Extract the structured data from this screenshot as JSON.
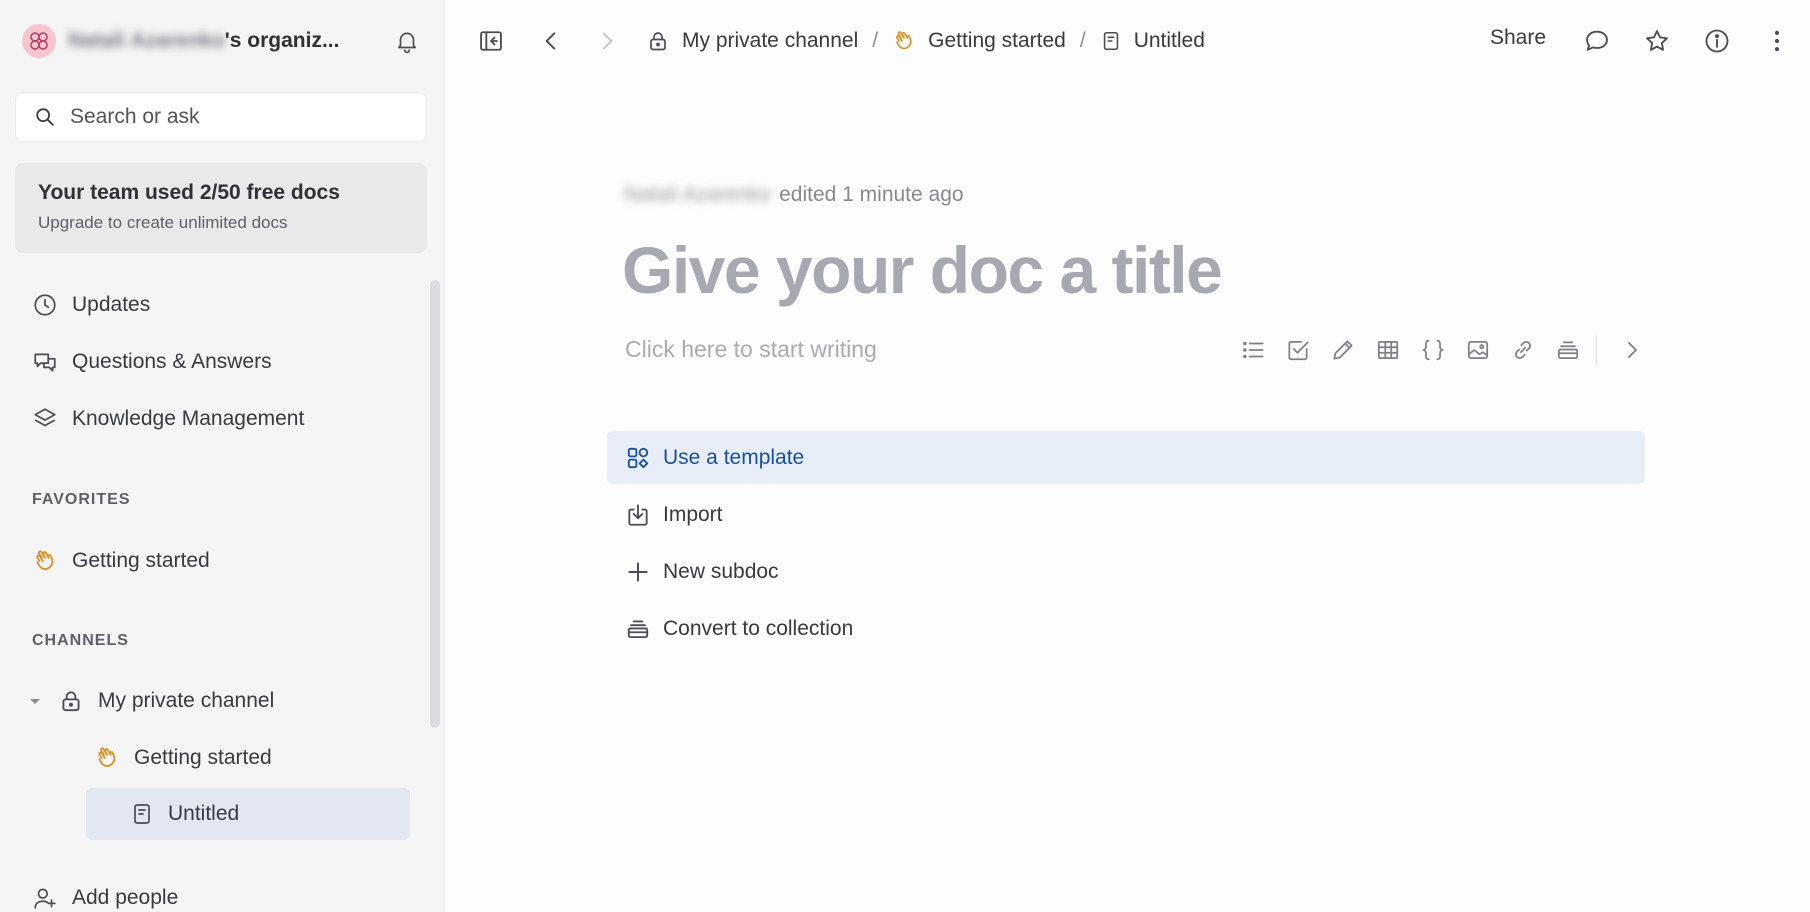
{
  "sidebar": {
    "org": {
      "owner_name": "Natali Azarenko",
      "name_suffix": "'s organiz..."
    },
    "search": {
      "placeholder": "Search or ask"
    },
    "upgrade": {
      "title": "Your team used 2/50 free docs",
      "subtitle": "Upgrade to create unlimited docs"
    },
    "nav": [
      {
        "label": "Updates",
        "icon": "clock-icon"
      },
      {
        "label": "Questions & Answers",
        "icon": "chat-bubbles-icon"
      },
      {
        "label": "Knowledge Management",
        "icon": "layers-icon"
      }
    ],
    "favorites": {
      "heading": "FAVORITES",
      "items": [
        {
          "label": "Getting started",
          "icon": "waving-hand-icon"
        }
      ]
    },
    "channels": {
      "heading": "CHANNELS",
      "channel": {
        "label": "My private channel",
        "icon": "lock-icon",
        "expanded": true
      },
      "children": [
        {
          "label": "Getting started",
          "icon": "waving-hand-icon"
        },
        {
          "label": "Untitled",
          "icon": "document-icon",
          "selected": true
        }
      ]
    },
    "add_people": "Add people"
  },
  "topbar": {
    "breadcrumbs": [
      {
        "label": "My private channel",
        "icon": "lock-icon"
      },
      {
        "label": "Getting started",
        "icon": "waving-hand-icon"
      },
      {
        "label": "Untitled",
        "icon": "document-icon"
      }
    ],
    "separator": "/",
    "share_label": "Share"
  },
  "editor": {
    "editor_name": "Natali Azarenko",
    "edited_text": "edited 1 minute ago",
    "title_placeholder": "Give your doc a title",
    "body_placeholder": "Click here to start writing",
    "format_tools": [
      "bulleted-list-icon",
      "checklist-icon",
      "pencil-icon",
      "table-icon",
      "code-braces-icon",
      "image-icon",
      "link-icon",
      "collection-icon",
      "chevron-right-icon"
    ],
    "actions": [
      {
        "label": "Use a template",
        "icon": "template-icon"
      },
      {
        "label": "Import",
        "icon": "import-icon"
      },
      {
        "label": "New subdoc",
        "icon": "plus-icon"
      },
      {
        "label": "Convert to collection",
        "icon": "collection-icon"
      }
    ]
  },
  "colors": {
    "accent": "#1a4fa0",
    "highlight_bg": "#e8eef8",
    "sidebar_bg": "#f5f5f6",
    "emoji": "#e0a030"
  }
}
